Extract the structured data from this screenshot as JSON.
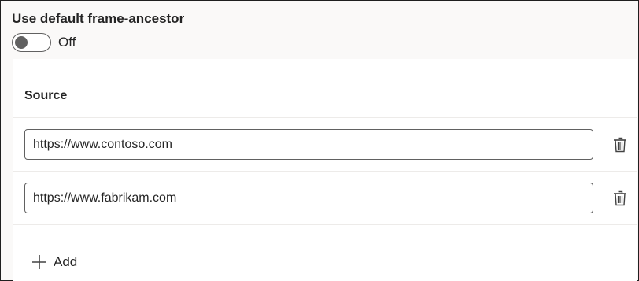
{
  "setting": {
    "title": "Use default frame-ancestor",
    "toggle_state": "Off",
    "toggle_on": false
  },
  "table": {
    "header": "Source",
    "rows": [
      {
        "value": "https://www.contoso.com",
        "action_icon": "trash-icon"
      },
      {
        "value": "https://www.fabrikam.com",
        "action_icon": "trash-icon"
      }
    ]
  },
  "add": {
    "label": "Add",
    "icon": "plus-icon"
  },
  "colors": {
    "border": "#616161",
    "divider": "#edebe9",
    "text": "#242424",
    "background": "#faf9f8"
  }
}
